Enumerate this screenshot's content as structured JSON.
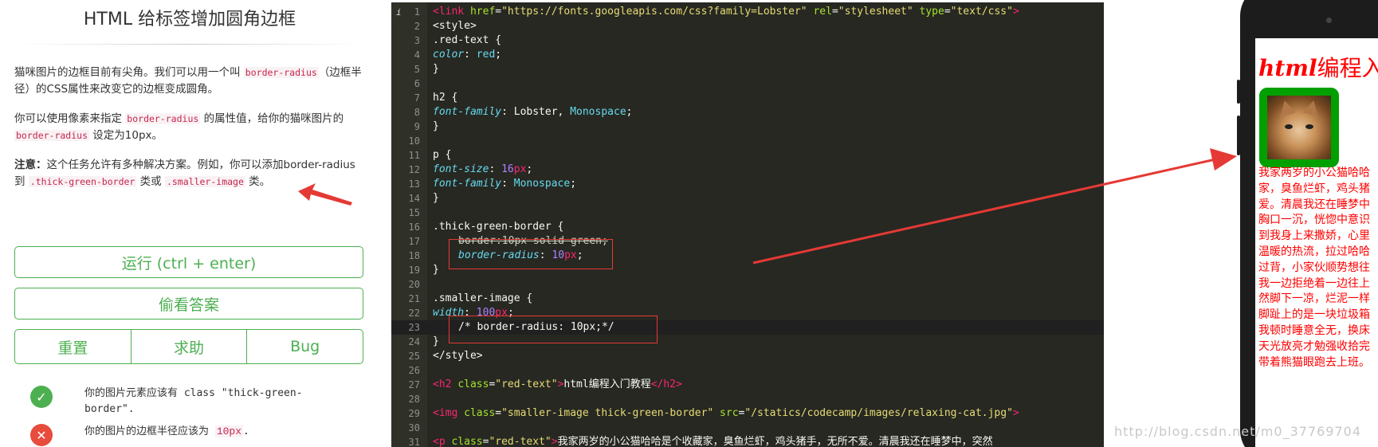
{
  "instructions": {
    "title": "HTML 给标签增加圆角边框",
    "para1": {
      "text_a": "猫咪图片的边框目前有尖角。我们可以用一个叫 ",
      "code_a": "border-radius",
      "text_b": "（边框半径）的CSS属性来改变它的边框变成圆角。"
    },
    "para2": {
      "text_a": "你可以使用像素来指定 ",
      "code_a": "border-radius",
      "text_b": " 的属性值，给你的猫咪图片的 ",
      "code_b": "border-radius",
      "text_c": " 设定为10px。"
    },
    "para3": {
      "bold": "注意：",
      "text_a": "这个任务允许有多种解决方案。例如，你可以添加border-radius到 ",
      "code_a": ".thick-green-border",
      "text_b": " 类或 ",
      "code_b": ".smaller-image",
      "text_c": " 类。"
    }
  },
  "buttons": {
    "run": "运行 (ctrl + enter)",
    "answer": "偷看答案",
    "reset": "重置",
    "help": "求助",
    "bug": "Bug"
  },
  "tests": [
    {
      "status": "pass",
      "text": "你的图片元素应该有 class \"thick-green-border\"."
    },
    {
      "status": "fail",
      "text_a": "你的图片的边框半径应该为 ",
      "code": "10px",
      "text_b": "."
    }
  ],
  "editor": {
    "info_marker": "i",
    "lines": [
      "1",
      "2",
      "3",
      "4",
      "5",
      "6",
      "7",
      "8",
      "9",
      "10",
      "11",
      "12",
      "13",
      "14",
      "15",
      "16",
      "17",
      "18",
      "19",
      "20",
      "21",
      "22",
      "23",
      "24",
      "25",
      "26",
      "27",
      "28",
      "29",
      "30",
      "31"
    ],
    "code": {
      "l1_tag": "<link ",
      "l1_a1": "href",
      "l1_v1": "\"https://fonts.googleapis.com/css?family=Lobster\"",
      "l1_a2": "rel",
      "l1_v2": "\"stylesheet\"",
      "l1_a3": "type",
      "l1_v3": "\"text/css\"",
      "l1_end": ">",
      "l2": "<style>",
      "l3": ".red-text {",
      "l4_prop": "color",
      "l4_val": "red",
      "l5": "}",
      "l7": "h2 {",
      "l8_prop": "font-family",
      "l8_v1": "Lobster",
      "l8_v2": "Monospace",
      "l9": "}",
      "l11": "p {",
      "l12_prop": "font-size",
      "l12_num": "16",
      "l12_unit": "px",
      "l13_prop": "font-family",
      "l13_val": "Monospace",
      "l14": "}",
      "l16": ".thick-green-border {",
      "l17": "border:10px solid green;",
      "l18_prop": "border-radius",
      "l18_num": "10",
      "l18_unit": "px",
      "l19": "}",
      "l21": ".smaller-image {",
      "l22_prop": "width",
      "l22_num": "100",
      "l22_unit": "px",
      "l23": "/* border-radius: 10px;*/",
      "l24": "}",
      "l25": "</style>",
      "l27_tag": "<h2 ",
      "l27_attr": "class",
      "l27_val": "\"red-text\"",
      "l27_text": "html编程入门教程",
      "l27_close": "</h2>",
      "l29_tag": "<img ",
      "l29_a1": "class",
      "l29_v1": "\"smaller-image thick-green-border\"",
      "l29_a2": "src",
      "l29_v2": "\"/statics/codecamp/images/relaxing-cat.jpg\"",
      "l29_end": ">",
      "l31_tag": "<p ",
      "l31_attr": "class",
      "l31_val": "\"red-text\"",
      "l31_text": "我家两岁的小公猫哈哈是个收藏家，臭鱼烂虾，鸡头猪手，无所不爱。清晨我还在睡梦中，突然"
    }
  },
  "preview": {
    "title_italic": "html",
    "title_rest": "编程入门",
    "paragraph": "我家两岁的小公猫哈哈\n家，臭鱼烂虾，鸡头猪\n爱。清晨我还在睡梦中\n胸口一沉，恍惚中意识\n到我身上来撒娇，心里\n温暖的热流，拉过哈哈\n过背，小家伙顺势想往\n我一边拒绝着一边往上\n然脚下一凉，烂泥一样\n脚趾上的是一块垃圾箱\n我顿时睡意全无，换床\n天光放亮才勉强收拾完\n带着熊猫眼跑去上班。"
  },
  "watermark": "http://blog.csdn.net/m0_37769704",
  "colors": {
    "accent_green": "#4caf50",
    "editor_bg": "#272822",
    "annotation_red": "#e53935"
  }
}
